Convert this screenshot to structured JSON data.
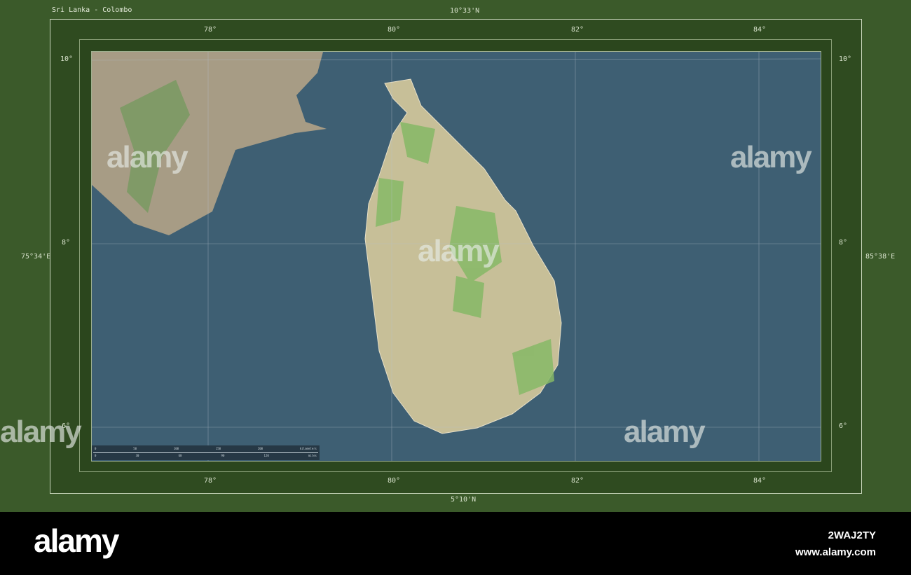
{
  "title": "Sri Lanka - Colombo",
  "bounds": {
    "north": "10°33'N",
    "south": "5°10'N",
    "west": "75°34'E",
    "east": "85°38'E"
  },
  "longitude_ticks": [
    "78°",
    "80°",
    "82°",
    "84°"
  ],
  "latitude_ticks": [
    "10°",
    "8°",
    "6°"
  ],
  "scale_bar": {
    "km_ticks": [
      "0",
      "50",
      "100",
      "150",
      "200"
    ],
    "km_unit": "kilometers",
    "mi_ticks": [
      "0",
      "30",
      "60",
      "90",
      "120"
    ],
    "mi_unit": "miles"
  },
  "watermark": "alamy",
  "footer": {
    "logo": "alamy",
    "image_id": "2WAJ2TY",
    "url": "www.alamy.com"
  },
  "colors": {
    "sea": "#3e5f73",
    "land": "#bdb58e",
    "vegetation": "#8cbf6a",
    "frame": "#3b5a2a"
  }
}
